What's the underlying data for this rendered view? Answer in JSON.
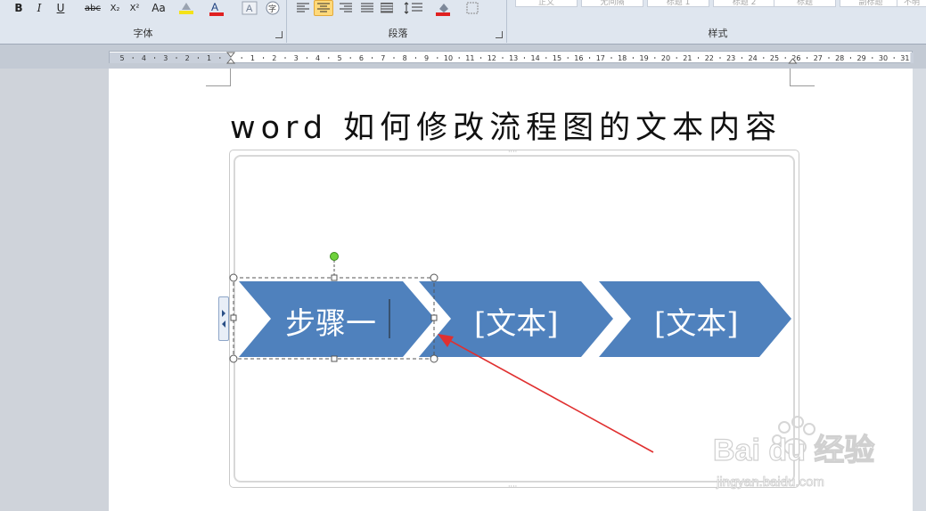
{
  "ribbon": {
    "font_group": {
      "label": "字体"
    },
    "paragraph_group": {
      "label": "段落"
    },
    "styles_group": {
      "label": "样式"
    },
    "font_buttons": [
      "B",
      "I",
      "U",
      "abc",
      "X₂",
      "X²",
      "Aa"
    ],
    "styles": [
      "正文",
      "无间隔",
      "标题 1",
      "标题 2",
      "标题",
      "副标题",
      "不明"
    ]
  },
  "ruler": {
    "left_numbers": [
      "5",
      "4",
      "3",
      "2",
      "1"
    ],
    "right_numbers": [
      "1",
      "2",
      "3",
      "4",
      "5",
      "6",
      "7",
      "8",
      "9",
      "10",
      "11",
      "12",
      "13",
      "14",
      "15",
      "16",
      "17",
      "18",
      "19",
      "20",
      "21",
      "22",
      "23",
      "24",
      "25",
      "26",
      "27",
      "28",
      "29",
      "30",
      "31"
    ]
  },
  "document": {
    "title": "word 如何修改流程图的文本内容"
  },
  "smartart": {
    "steps": [
      {
        "text": "步骤一"
      },
      {
        "text": "[文本]"
      },
      {
        "text": "[文本]"
      }
    ],
    "fill_color": "#4f81bd"
  },
  "watermark": {
    "brand": "Bai du 经验",
    "url": "jingyan.baidu.com"
  }
}
